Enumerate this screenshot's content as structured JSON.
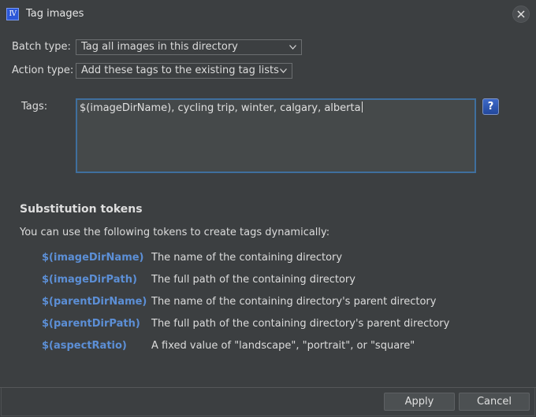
{
  "window": {
    "title": "Tag images",
    "app_icon": "IV"
  },
  "batch_type": {
    "label": "Batch type:",
    "selected": "Tag all images in this directory"
  },
  "action_type": {
    "label": "Action type:",
    "selected": "Add these tags to the existing tag lists"
  },
  "tags": {
    "label": "Tags:",
    "value": "$(imageDirName), cycling trip, winter, calgary, alberta"
  },
  "help_button": {
    "label": "?"
  },
  "substitution": {
    "heading": "Substitution tokens",
    "intro": "You can use the following tokens to create tags dynamically:",
    "tokens": [
      {
        "name": "$(imageDirName)",
        "desc": "The name of the containing directory"
      },
      {
        "name": "$(imageDirPath)",
        "desc": "The full path of the containing directory"
      },
      {
        "name": "$(parentDirName)",
        "desc": "The name of the containing directory's parent directory"
      },
      {
        "name": "$(parentDirPath)",
        "desc": "The full path of the containing directory's parent directory"
      },
      {
        "name": "$(aspectRatio)",
        "desc": "A fixed value of \"landscape\", \"portrait\", or \"square\""
      }
    ]
  },
  "buttons": {
    "apply": "Apply",
    "cancel": "Cancel"
  },
  "colors": {
    "background": "#3c3f41",
    "token_accent": "#5c8fd6",
    "focus_border": "#3f6f9e",
    "help_button": "#2f5bbd"
  },
  "icons": {
    "close": "close-icon",
    "dropdown": "chevron-down-icon",
    "help": "help-icon",
    "app": "app-icon"
  }
}
